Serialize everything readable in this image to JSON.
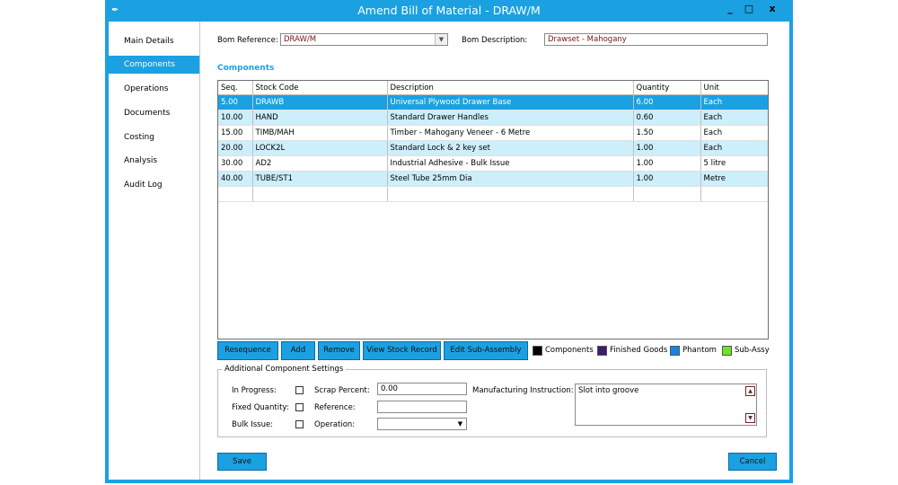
{
  "window": {
    "title": "Amend Bill of Material - DRAW/M",
    "minimize": "_",
    "maximize": "□",
    "close": "x"
  },
  "sidebar": {
    "items": [
      {
        "label": "Main Details"
      },
      {
        "label": "Components",
        "active": true
      },
      {
        "label": "Operations"
      },
      {
        "label": "Documents"
      },
      {
        "label": "Costing"
      },
      {
        "label": "Analysis"
      },
      {
        "label": "Audit Log"
      }
    ]
  },
  "header": {
    "bom_reference_label": "Bom Reference:",
    "bom_reference_value": "DRAW/M",
    "bom_description_label": "Bom Description:",
    "bom_description_value": "Drawset - Mahogany"
  },
  "components": {
    "title": "Components",
    "columns": [
      "Seq.",
      "Stock Code",
      "Description",
      "Quantity",
      "Unit"
    ],
    "rows": [
      {
        "seq": "5.00",
        "code": "DRAWB",
        "desc": "Universal Plywood Drawer Base",
        "qty": "6.00",
        "unit": "Each"
      },
      {
        "seq": "10.00",
        "code": "HAND",
        "desc": "Standard Drawer Handles",
        "qty": "0.60",
        "unit": "Each"
      },
      {
        "seq": "15.00",
        "code": "TIMB/MAH",
        "desc": "Timber - Mahogany Veneer - 6 Metre",
        "qty": "1.50",
        "unit": "Each"
      },
      {
        "seq": "20.00",
        "code": "LOCK2L",
        "desc": "Standard Lock & 2 key set",
        "qty": "1.00",
        "unit": "Each"
      },
      {
        "seq": "30.00",
        "code": "AD2",
        "desc": "Industrial Adhesive - Bulk Issue",
        "qty": "1.00",
        "unit": "5 litre"
      },
      {
        "seq": "40.00",
        "code": "TUBE/ST1",
        "desc": "Steel Tube 25mm Dia",
        "qty": "1.00",
        "unit": "Metre"
      }
    ]
  },
  "actions": {
    "resequence": "Resequence",
    "add": "Add",
    "remove": "Remove",
    "view_stock_record": "View Stock Record",
    "edit_sub_assembly": "Edit Sub-Assembly"
  },
  "legend": [
    {
      "label": "Components",
      "color": "#000000"
    },
    {
      "label": "Finished Goods",
      "color": "#3b1c6e"
    },
    {
      "label": "Phantom",
      "color": "#1b82e0"
    },
    {
      "label": "Sub-Assy",
      "color": "#6fe31f"
    }
  ],
  "settings": {
    "title": "Additional Component Settings",
    "in_progress_label": "In Progress:",
    "fixed_quantity_label": "Fixed Quantity:",
    "bulk_issue_label": "Bulk Issue:",
    "scrap_percent_label": "Scrap Percent:",
    "scrap_percent_value": "0.00",
    "reference_label": "Reference:",
    "reference_value": "",
    "operation_label": "Operation:",
    "operation_value": "",
    "manufacturing_instruction_label": "Manufacturing Instruction:",
    "manufacturing_instruction_value": "Slot into groove"
  },
  "footer": {
    "save": "Save",
    "cancel": "Cancel"
  },
  "colors": {
    "accent": "#1ba1e2",
    "selected_row": "#1ba1e2",
    "alt_row": "#cdeefb"
  }
}
